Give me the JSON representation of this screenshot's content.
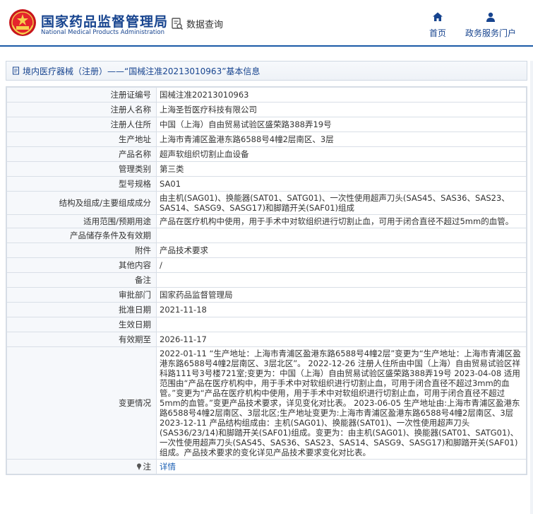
{
  "header": {
    "brand_cn": "国家药品监督管理局",
    "brand_en": "National Medical Products Administration",
    "db_link": "数据查询",
    "nav": [
      {
        "label": "首页",
        "icon": "home-icon"
      },
      {
        "label": "政务服务门户",
        "icon": "user-icon"
      }
    ]
  },
  "breadcrumb": "境内医疗器械（注册）——“国械注准20213010963”基本信息",
  "colors": {
    "brand": "#17448f",
    "link": "#1b5fb3",
    "label_bg": "#f6f8fb"
  },
  "rows": [
    {
      "label": "注册证编号",
      "value": "国械注准20213010963"
    },
    {
      "label": "注册人名称",
      "value": "上海圣哲医疗科技有限公司"
    },
    {
      "label": "注册人住所",
      "value": "中国（上海）自由贸易试验区盛荣路388弄19号"
    },
    {
      "label": "生产地址",
      "value": "上海市青浦区盈港东路6588号4幢2层南区、3层"
    },
    {
      "label": "产品名称",
      "value": "超声软组织切割止血设备"
    },
    {
      "label": "管理类别",
      "value": "第三类"
    },
    {
      "label": "型号规格",
      "value": "SA01"
    },
    {
      "label": "结构及组成/主要组成成分",
      "value": "由主机(SAG01)、换能器(SAT01、SATG01)、一次性使用超声刀头(SAS45、SAS36、SAS23、SAS14、SASG9、SASG17)和脚踏开关(SAF01)组成"
    },
    {
      "label": "适用范围/预期用途",
      "value": "产品在医疗机构中使用，用于手术中对软组织进行切割止血，可用于闭合直径不超过5mm的血管。"
    },
    {
      "label": "产品储存条件及有效期",
      "value": ""
    },
    {
      "label": "附件",
      "value": "产品技术要求"
    },
    {
      "label": "其他内容",
      "value": "/"
    },
    {
      "label": "备注",
      "value": ""
    },
    {
      "label": "审批部门",
      "value": "国家药品监督管理局"
    },
    {
      "label": "批准日期",
      "value": "2021-11-18"
    },
    {
      "label": "生效日期",
      "value": ""
    },
    {
      "label": "有效期至",
      "value": "2026-11-17"
    },
    {
      "label": "变更情况",
      "value": "2022-01-11 “生产地址：上海市青浦区盈港东路6588号4幢2层”变更为“生产地址：上海市青浦区盈港东路6588号4幢2层南区、3层北区”。 2022-12-26 注册人住所由中国（上海）自由贸易试验区祥科路111号3号楼721室;变更为：中国（上海）自由贸易试验区盛荣路388弄19号 2023-04-08 适用范围由“产品在医疗机构中，用于手术中对软组织进行切割止血，可用于闭合直径不超过3mm的血管。”变更为“产品在医疗机构中使用，用于手术中对软组织进行切割止血，可用于闭合直径不超过5mm的血管。”变更产品技术要求，详见变化对比表。 2023-06-05 生产地址由:上海市青浦区盈港东路6588号4幢2层南区、3层北区;生产地址变更为:上海市青浦区盈港东路6588号4幢2层南区、3层 2023-12-11 产品结构组成由：主机(SAG01)、换能器(SAT01)、一次性使用超声刀头(SAS36/23/14)和脚踏开关(SAF01)组成。变更为：由主机(SAG01)、换能器(SAT01、SATG01)、一次性使用超声刀头(SAS45、SAS36、SAS23、SAS14、SASG9、SASG17)和脚踏开关(SAF01)组成。产品技术要求的变化详见产品技术要求变化对比表。"
    },
    {
      "label": "注",
      "value": "详情",
      "is_link": true
    }
  ]
}
